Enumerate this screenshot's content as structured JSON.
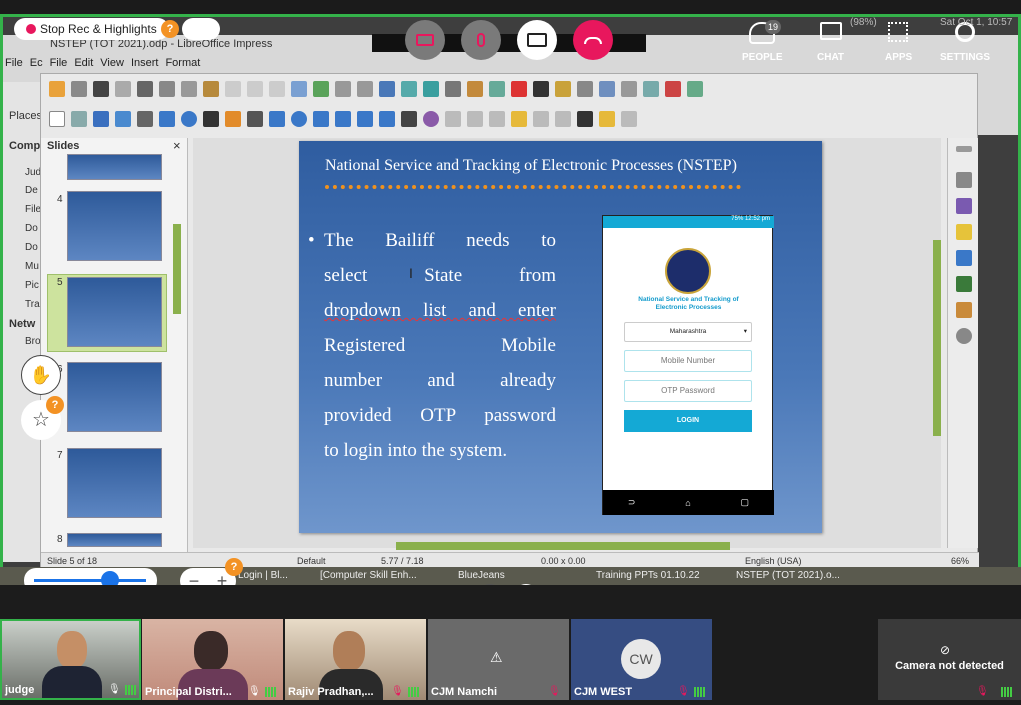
{
  "system": {
    "status_right": "(98%)",
    "datetime": "Sat Oct  1, 10:57"
  },
  "window": {
    "title": "NSTEP (TOT 2021).odp - LibreOffice Impress"
  },
  "bg_menu": [
    "File",
    "Ec",
    "File",
    "Edit",
    "View",
    "Insert",
    "Format"
  ],
  "bg_sidebar": {
    "heading1": "Comp",
    "items": [
      "Judg",
      "De",
      "File",
      "Do",
      "Do",
      "Mu",
      "Pic",
      "Tra"
    ],
    "heading2": "Netw",
    "items2": [
      "Bro"
    ],
    "places": "Places"
  },
  "meeting": {
    "record_label": "Stop Rec & Highlights",
    "help_badge": "?",
    "people_count": "19",
    "nav": [
      {
        "label": "PEOPLE"
      },
      {
        "label": "CHAT"
      },
      {
        "label": "APPS"
      },
      {
        "label": "SETTINGS"
      }
    ]
  },
  "slides_panel": {
    "title": "Slides",
    "close": "×",
    "numbers": [
      "4",
      "5",
      "6",
      "7",
      "8"
    ]
  },
  "slide": {
    "title": "National Service and Tracking of Electronic Processes (NSTEP)",
    "bullet_lines": [
      "The Bailiff needs to",
      "select State from",
      "dropdown list and enter",
      "Registered Mobile",
      "number and already",
      "provided OTP password",
      "to login into the system."
    ],
    "bullet_symbol": "•",
    "cursor": "I"
  },
  "phone": {
    "status": "75% 12:52 pm",
    "app_title": "National Service and Tracking of Electronic Processes",
    "state_select": "Maharashtra",
    "mobile_placeholder": "Mobile Number",
    "otp_placeholder": "OTP Password",
    "login_label": "LOGIN",
    "nav": [
      "⊃",
      "⌂",
      "▢"
    ]
  },
  "statusbar": {
    "slide_info": "Slide 5 of 18",
    "layout": "Default",
    "position": "5.77 / 7.18",
    "size": "0.00 x 0.00",
    "language": "English (USA)",
    "zoom": "66%"
  },
  "taskbar": {
    "items": [
      "Login | Bl...",
      "[Computer Skill Enh...",
      "BlueJeans",
      "Training PPTs 01.10.22",
      "NSTEP (TOT 2021).o..."
    ]
  },
  "participants": [
    {
      "name": "judge"
    },
    {
      "name": "Principal Distri..."
    },
    {
      "name": "Rajiv Pradhan,..."
    },
    {
      "name": "CJM Namchi"
    },
    {
      "name": "CJM WEST",
      "initials": "CW"
    },
    {
      "name": "Camera not detected"
    }
  ],
  "colors": {
    "accent_green": "#34b24a",
    "rec_pink": "#e8175d",
    "slide_blue": "#2f5da0",
    "app_blue": "#14a9d5",
    "hangup_red": "#e8175d"
  }
}
